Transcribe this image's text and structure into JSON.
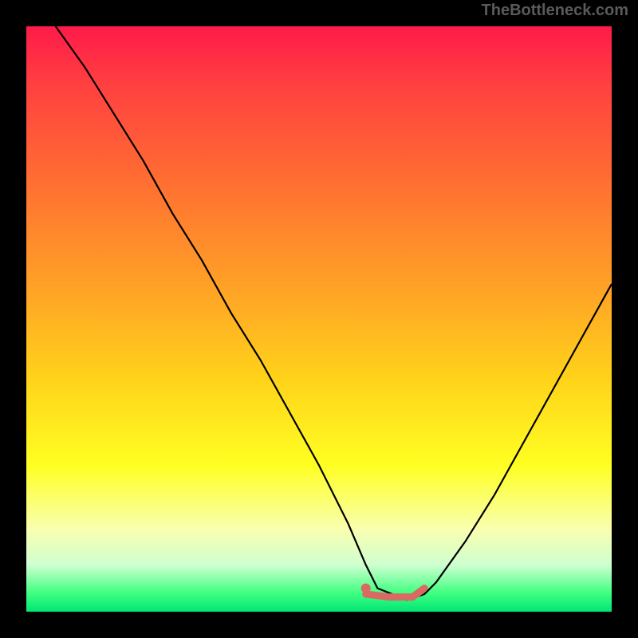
{
  "watermark": "TheBottleneck.com",
  "chart_data": {
    "type": "line",
    "title": "",
    "xlabel": "",
    "ylabel": "",
    "xlim": [
      0,
      100
    ],
    "ylim": [
      0,
      100
    ],
    "series": [
      {
        "name": "bottleneck-curve",
        "color": "#000000",
        "x": [
          5,
          10,
          15,
          20,
          25,
          30,
          35,
          40,
          45,
          50,
          55,
          58,
          60,
          65,
          68,
          70,
          75,
          80,
          85,
          90,
          95,
          100
        ],
        "y": [
          100,
          93,
          85,
          77,
          68,
          60,
          51,
          43,
          34,
          25,
          15,
          8,
          4,
          2,
          3,
          5,
          12,
          20,
          29,
          38,
          47,
          56
        ]
      },
      {
        "name": "optimal-marker",
        "color": "#d96a63",
        "type": "scatter",
        "x": [
          58
        ],
        "y": [
          4
        ]
      },
      {
        "name": "optimal-range",
        "color": "#d96a63",
        "type": "line",
        "x": [
          58,
          62,
          66,
          68
        ],
        "y": [
          3,
          2.5,
          2.5,
          4
        ]
      }
    ],
    "gradient_stops": [
      {
        "pos": 0,
        "color": "#ff1a4a"
      },
      {
        "pos": 25,
        "color": "#ff6a33"
      },
      {
        "pos": 60,
        "color": "#ffd21a"
      },
      {
        "pos": 86,
        "color": "#f8ffb0"
      },
      {
        "pos": 100,
        "color": "#00e676"
      }
    ]
  }
}
